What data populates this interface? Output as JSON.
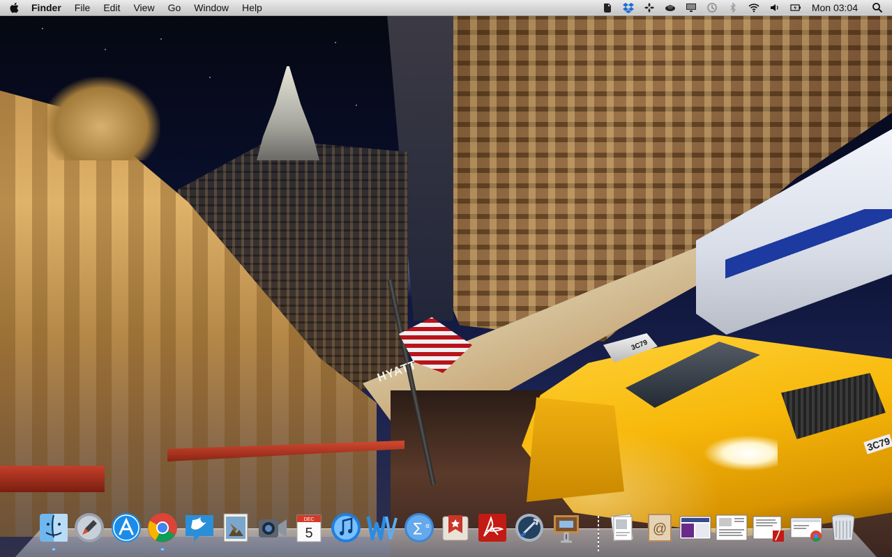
{
  "menubar": {
    "apple_icon": "apple-logo-icon",
    "app_name": "Finder",
    "menus": [
      "File",
      "Edit",
      "View",
      "Go",
      "Window",
      "Help"
    ],
    "status_icons": [
      "evernote-icon",
      "dropbox-icon",
      "sketchbook-icon",
      "cloud-icon",
      "display-icon",
      "time-machine-icon",
      "bluetooth-icon",
      "wifi-icon",
      "volume-icon",
      "battery-icon"
    ],
    "clock": "Mon 03:04",
    "spotlight_icon": "spotlight-search-icon"
  },
  "wallpaper": {
    "hotel_sign": "HYATT",
    "taxi_roof_number": "3C79",
    "taxi_plate": "3C79"
  },
  "dock": {
    "apps": [
      {
        "name": "Finder",
        "icon": "finder-icon",
        "running": true
      },
      {
        "name": "Launchpad",
        "icon": "launchpad-icon",
        "running": false
      },
      {
        "name": "App Store",
        "icon": "app-store-icon",
        "running": false
      },
      {
        "name": "Google Chrome",
        "icon": "chrome-icon",
        "running": true
      },
      {
        "name": "Twitter",
        "icon": "twitter-icon",
        "running": false
      },
      {
        "name": "Preview",
        "icon": "preview-icon",
        "running": false
      },
      {
        "name": "FaceTime",
        "icon": "facetime-icon",
        "running": false
      },
      {
        "name": "Calendar",
        "icon": "calendar-icon",
        "running": false,
        "month": "DEC",
        "day": "5"
      },
      {
        "name": "iTunes",
        "icon": "itunes-icon",
        "running": false
      },
      {
        "name": "Word",
        "icon": "word-icon",
        "running": false
      },
      {
        "name": "Calculator",
        "icon": "calculator-icon",
        "running": false
      },
      {
        "name": "Wunderlist",
        "icon": "wunderlist-icon",
        "running": false
      },
      {
        "name": "Adobe Reader",
        "icon": "adobe-reader-icon",
        "running": false
      },
      {
        "name": "Xcode",
        "icon": "xcode-icon",
        "running": false
      },
      {
        "name": "Keynote",
        "icon": "keynote-icon",
        "running": false
      }
    ],
    "folders": [
      {
        "name": "Documents",
        "icon": "documents-stack-icon"
      },
      {
        "name": "Contacts",
        "icon": "contacts-icon"
      },
      {
        "name": "Screenshot 1",
        "icon": "screenshot-stack-icon"
      },
      {
        "name": "Document 1",
        "icon": "document-stack-icon"
      },
      {
        "name": "PDF",
        "icon": "pdf-stack-icon"
      },
      {
        "name": "Downloads",
        "icon": "downloads-stack-icon"
      },
      {
        "name": "Trash",
        "icon": "trash-icon"
      }
    ]
  },
  "colors": {
    "menubar_bg": "#e8e8e8",
    "dock_indicator": "#4aa3ff",
    "taxi_yellow": "#f7b80a",
    "sky": "#0a1030"
  }
}
